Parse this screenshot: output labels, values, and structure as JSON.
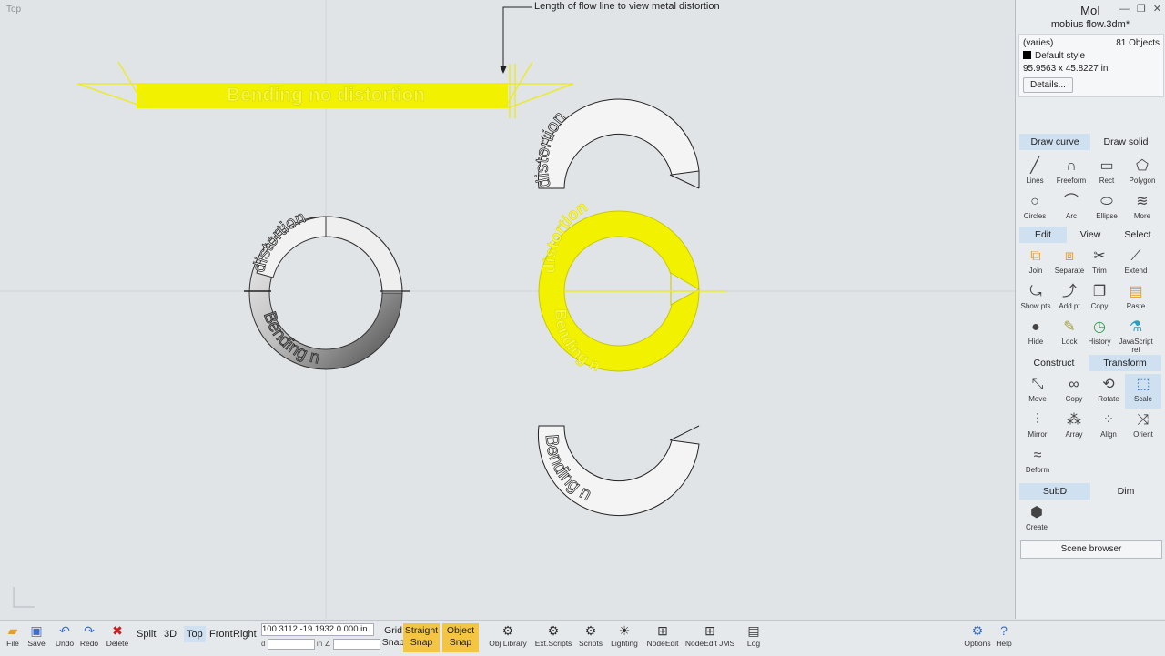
{
  "app": {
    "title": "MoI",
    "filename": "mobius flow.3dm*"
  },
  "viewport": {
    "label": "Top",
    "annotation": "Length of flow line to view metal distortion"
  },
  "scene_text": {
    "banner": "Bending no distortion",
    "ring_top": "distortion",
    "ring_bottom": "Bending n",
    "arc_top": "distortion",
    "arc_bottom": "Bending n",
    "yellow_top": "distortion",
    "yellow_bottom": "Bending n"
  },
  "properties": {
    "name": "(varies)",
    "count": "81 Objects",
    "style": "Default style",
    "size": "95.9563 x 45.8227 in",
    "details_label": "Details..."
  },
  "draw_tabs": {
    "curve": "Draw curve",
    "solid": "Draw solid"
  },
  "draw_tools": [
    {
      "label": "Lines",
      "icon": "line-icon"
    },
    {
      "label": "Freeform",
      "icon": "freeform-icon"
    },
    {
      "label": "Rect",
      "icon": "rect-icon"
    },
    {
      "label": "Polygon",
      "icon": "polygon-icon"
    },
    {
      "label": "Circles",
      "icon": "circle-icon"
    },
    {
      "label": "Arc",
      "icon": "arc-icon"
    },
    {
      "label": "Ellipse",
      "icon": "ellipse-icon"
    },
    {
      "label": "More",
      "icon": "spring-icon"
    }
  ],
  "edit_tabs": {
    "edit": "Edit",
    "view": "View",
    "select": "Select"
  },
  "edit_tools": [
    {
      "label": "Join"
    },
    {
      "label": "Separate"
    },
    {
      "label": "Trim"
    },
    {
      "label": "Extend"
    },
    {
      "label": "Show pts"
    },
    {
      "label": "Add pt"
    },
    {
      "label": "Copy"
    },
    {
      "label": "Paste"
    },
    {
      "label": "Hide"
    },
    {
      "label": "Lock"
    },
    {
      "label": "History"
    },
    {
      "label": "JavaScript ref"
    }
  ],
  "transform_tabs": {
    "construct": "Construct",
    "transform": "Transform"
  },
  "transform_tools": [
    {
      "label": "Move"
    },
    {
      "label": "Copy"
    },
    {
      "label": "Rotate"
    },
    {
      "label": "Scale"
    },
    {
      "label": "Mirror"
    },
    {
      "label": "Array"
    },
    {
      "label": "Align"
    },
    {
      "label": "Orient"
    },
    {
      "label": "Deform"
    }
  ],
  "subd_tabs": {
    "subd": "SubD",
    "dim": "Dim"
  },
  "subd_tools": [
    {
      "label": "Create"
    }
  ],
  "scene_browser": "Scene browser",
  "bottom": {
    "file": "File",
    "save": "Save",
    "undo": "Undo",
    "redo": "Redo",
    "delete": "Delete",
    "views": [
      "Split",
      "3D",
      "Top",
      "Front",
      "Right"
    ],
    "coords": "100.3112 -19.1932 0.000",
    "coord_unit": "in",
    "coord_d": "d",
    "coord_in": "in ∠",
    "grid_snap": [
      "Grid",
      "Snap"
    ],
    "straight_snap": [
      "Straight",
      "Snap"
    ],
    "object_snap": [
      "Object",
      "Snap"
    ],
    "tools": [
      "Obj Library",
      "Ext.Scripts",
      "Scripts",
      "Lighting",
      "NodeEdit",
      "NodeEdit JMS",
      "Log"
    ],
    "options": "Options",
    "help": "Help"
  },
  "colors": {
    "accent": "#cfe0f1",
    "highlight": "#f2f200",
    "snap_on": "#f4c542"
  }
}
